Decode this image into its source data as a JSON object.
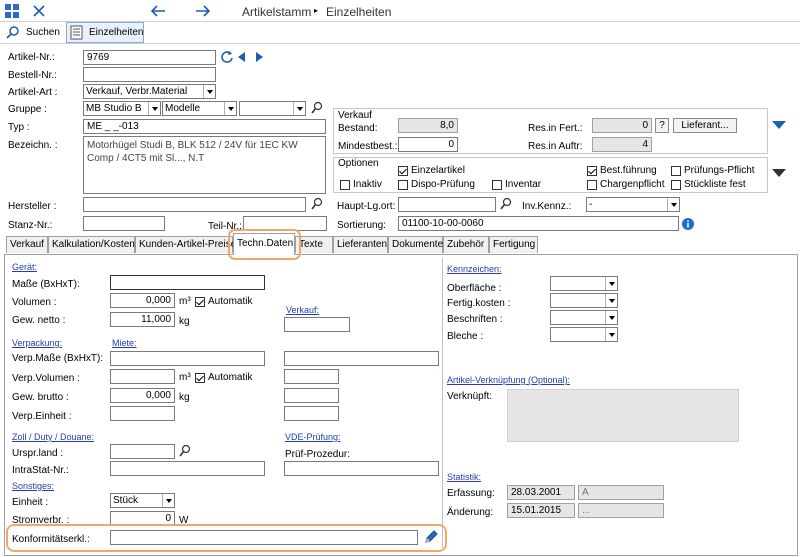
{
  "title_bar": {
    "title": "Artikelstamm",
    "subtitle": "Einzelheiten"
  },
  "toolbar": {
    "search_label": "Suchen",
    "details_label": "Einzelheiten"
  },
  "header": {
    "artikel_nr_label": "Artikel-Nr.:",
    "artikel_nr": "9769",
    "bestell_nr_label": "Bestell-Nr.:",
    "artikel_art_label": "Artikel-Art :",
    "artikel_art": "Verkauf, Verbr.Material",
    "gruppe_label": "Gruppe :",
    "gruppe1": "MB Studio B",
    "gruppe2": "Modelle",
    "typ_label": "Typ :",
    "typ": "ME _ _-013",
    "bezeichn_label": "Bezeichn. :",
    "bezeichn_line1": "Motorhügel Studi B, BLK 512 / 24V für 1EC KW",
    "bezeichn_line2": "Comp / 4CT5 mit Sl..., N.T",
    "hersteller_label": "Hersteller :",
    "stanz_nr_label": "Stanz-Nr.:",
    "teil_nr_label": "Teil-Nr.:",
    "haupt_lg_label": "Haupt-Lg.ort:",
    "inv_kennz_label": "Inv.Kennz.:",
    "inv_kennz": "-",
    "sortierung_label": "Sortierung:",
    "sortierung": "01100-10-00-0060"
  },
  "verkauf": {
    "group_title": "Verkauf",
    "bestand_label": "Bestand:",
    "bestand": "8,0",
    "mindestbest_label": "Mindestbest.:",
    "mindestbest": "0",
    "res_fert_label": "Res.in Fert.:",
    "res_fert": "0",
    "help_label": "?",
    "lieferant_label": "Lieferant...",
    "res_auftr_label": "Res.in Auftr:",
    "res_auftr": "4"
  },
  "optionen": {
    "group_title": "Optionen",
    "items": [
      {
        "label": "Einzelartikel",
        "checked": true
      },
      {
        "label": "Best.führung",
        "checked": true
      },
      {
        "label": "Prüfungs-Pflicht",
        "checked": false
      },
      {
        "label": "Inaktiv",
        "checked": false
      },
      {
        "label": "Dispo-Prüfung",
        "checked": false
      },
      {
        "label": "Inventar",
        "checked": false
      },
      {
        "label": "Chargenpflicht",
        "checked": false
      },
      {
        "label": "Stückliste fest",
        "checked": false
      }
    ]
  },
  "tabs": [
    "Verkauf",
    "Kalkulation/Kosten",
    "Kunden-Artikel-Preise",
    "Techn.Daten",
    "Texte",
    "Lieferanten",
    "Dokumente",
    "Zubehör",
    "Fertigung"
  ],
  "techn": {
    "geraet": "Gerät:",
    "masse_label": "Maße (BxHxT):",
    "volumen_label": "Volumen :",
    "volumen": "0,000",
    "unit_m3": "m³",
    "automatik": "Automatik",
    "gew_netto_label": "Gew. netto :",
    "gew_netto": "11,000",
    "unit_kg": "kg",
    "verkauf_sec": "Verkauf:",
    "verpackung": "Verpackung:",
    "miete": "Miete:",
    "verp_masse_label": "Verp.Maße (BxHxT):",
    "verp_volumen_label": "Verp.Volumen :",
    "gew_brutto_label": "Gew. brutto :",
    "gew_brutto": "0,000",
    "verp_einheit_label": "Verp.Einheit :",
    "zoll": "Zoll / Duty / Douane:",
    "vde": "VDE-Prüfung:",
    "urspr_label": "Urspr.land :",
    "pruef_label": "Prüf-Prozedur:",
    "intrastat_label": "IntraStat-Nr.:",
    "sonstiges": "Sonstiges:",
    "einheit_label": "Einheit :",
    "einheit": "Stück",
    "strom_label": "Stromverbr. :",
    "strom": "0",
    "unit_w": "W",
    "konf_label": "Konformitätserkl.:"
  },
  "kennzeichen": {
    "title": "Kennzeichen:",
    "items": [
      "Oberfläche :",
      "Fertig.kosten :",
      "Beschriften :",
      "Bleche :"
    ],
    "verkn_title": "Artikel-Verknüpfung (Optional):",
    "verkn_label": "Verknüpft:"
  },
  "statistik": {
    "title": "Statistik:",
    "erfassung_label": "Erfassung:",
    "erfassung": "28.03.2001",
    "erfassung_user": "A",
    "aenderung_label": "Änderung:",
    "aenderung": "15.01.2015",
    "aenderung_user": "..."
  },
  "colors": {
    "highlight": "#f0a868",
    "accent": "#1a5fb4",
    "link": "#1f3fb0"
  }
}
